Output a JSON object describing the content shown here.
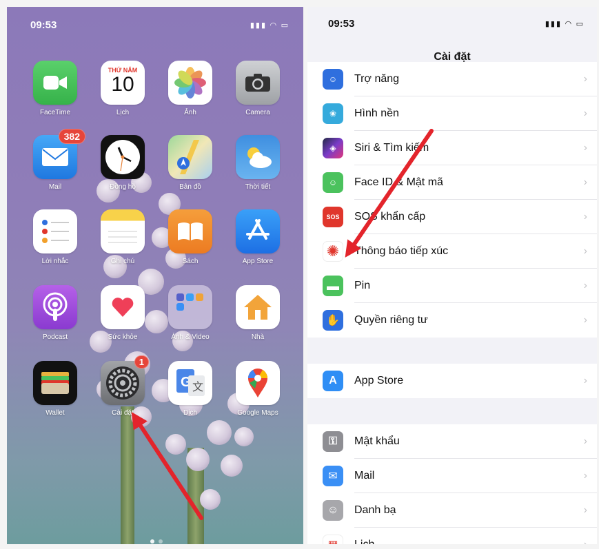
{
  "left_phone": {
    "time": "09:53",
    "status_icons": "▮▮▮ ◠ ▭",
    "apps": [
      {
        "label": "FaceTime",
        "icon": "facetime-icon"
      },
      {
        "label": "Lịch",
        "icon": "calendar-icon",
        "day_name": "THỨ NĂM",
        "day_number": "10"
      },
      {
        "label": "Ảnh",
        "icon": "photos-icon"
      },
      {
        "label": "Camera",
        "icon": "camera-icon"
      },
      {
        "label": "Mail",
        "icon": "mail-icon",
        "badge": "382"
      },
      {
        "label": "Đồng hồ",
        "icon": "clock-icon"
      },
      {
        "label": "Bản đồ",
        "icon": "maps-icon"
      },
      {
        "label": "Thời tiết",
        "icon": "weather-icon"
      },
      {
        "label": "Lời nhắc",
        "icon": "reminders-icon"
      },
      {
        "label": "Ghi chú",
        "icon": "notes-icon"
      },
      {
        "label": "Sách",
        "icon": "books-icon"
      },
      {
        "label": "App Store",
        "icon": "app-store-icon"
      },
      {
        "label": "Podcast",
        "icon": "podcast-icon"
      },
      {
        "label": "Sức khỏe",
        "icon": "health-icon"
      },
      {
        "label": "Ảnh & Video",
        "icon": "folder-icon"
      },
      {
        "label": "Nhà",
        "icon": "home-icon"
      },
      {
        "label": "Wallet",
        "icon": "wallet-icon"
      },
      {
        "label": "Cài đặt",
        "icon": "settings-icon",
        "badge": "1"
      },
      {
        "label": "Dịch",
        "icon": "translate-icon"
      },
      {
        "label": "Google Maps",
        "icon": "google-maps-icon"
      }
    ]
  },
  "right_phone": {
    "time": "09:53",
    "status_icons": "▮▮▮ ◠ ▭",
    "title": "Cài đặt",
    "groups": [
      [
        {
          "label": "Trợ năng",
          "color": "#2f6fde",
          "glyph": "☺"
        },
        {
          "label": "Hình nền",
          "color": "#35aadc",
          "glyph": "❀"
        },
        {
          "label": "Siri & Tìm kiếm",
          "color": "#222a44",
          "glyph": "◈"
        },
        {
          "label": "Face ID & Mật mã",
          "color": "#4bc25d",
          "glyph": "☺"
        },
        {
          "label": "SOS khẩn cấp",
          "color": "#e0362c",
          "glyph": "SOS"
        },
        {
          "label": "Thông báo tiếp xúc",
          "color": "#ffffff",
          "glyph": "✺"
        },
        {
          "label": "Pin",
          "color": "#4bc25d",
          "glyph": "▬"
        },
        {
          "label": "Quyền riêng tư",
          "color": "#2f6fde",
          "glyph": "✋"
        }
      ],
      [
        {
          "label": "App Store",
          "color": "#2f8ef5",
          "glyph": "A"
        }
      ],
      [
        {
          "label": "Mật khẩu",
          "color": "#8e8e93",
          "glyph": "⚿"
        },
        {
          "label": "Mail",
          "color": "#3a8ff5",
          "glyph": "✉"
        },
        {
          "label": "Danh bạ",
          "color": "#a7a7ab",
          "glyph": "☺"
        },
        {
          "label": "Lịch",
          "color": "#ffffff",
          "glyph": "▦"
        }
      ]
    ],
    "chevron": "›"
  },
  "colors": {
    "arrow": "#e3242b"
  }
}
